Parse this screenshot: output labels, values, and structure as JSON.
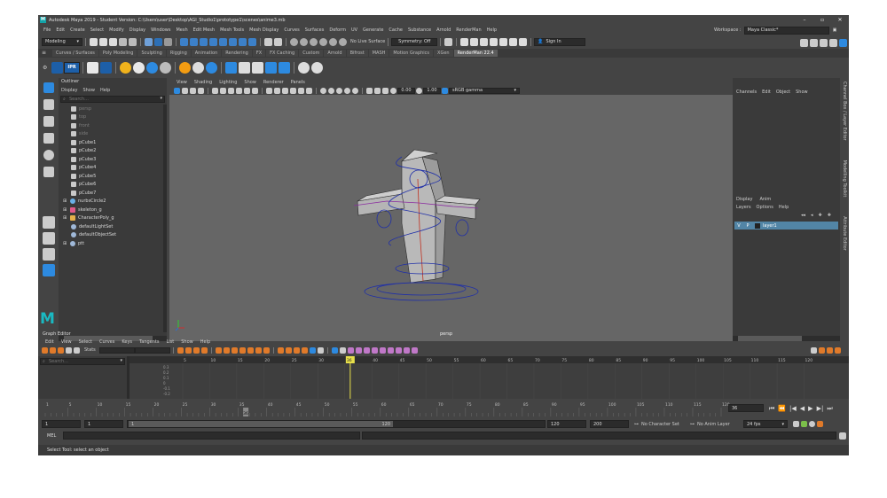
{
  "window": {
    "title": "Autodesk Maya 2019 - Student Version: C:\\Users\\user\\Desktop\\AGI_Studio1\\prototype1\\scenes\\anime3.mb"
  },
  "menubar": [
    "File",
    "Edit",
    "Create",
    "Select",
    "Modify",
    "Display",
    "Windows",
    "Mesh",
    "Edit Mesh",
    "Mesh Tools",
    "Mesh Display",
    "Curves",
    "Surfaces",
    "Deform",
    "UV",
    "Generate",
    "Cache",
    "Substance",
    "Arnold",
    "RenderMan",
    "Help"
  ],
  "workspace": {
    "label": "Workspace :",
    "value": "Maya Classic*"
  },
  "statusline": {
    "menuset": "Modeling",
    "live_surface": "No Live Surface",
    "symmetry": "Symmetry: Off",
    "sign_in": "Sign In"
  },
  "shelf_tabs": [
    "Curves / Surfaces",
    "Poly Modeling",
    "Sculpting",
    "Rigging",
    "Animation",
    "Rendering",
    "FX",
    "FX Caching",
    "Custom",
    "Arnold",
    "Bifrost",
    "MASH",
    "Motion Graphics",
    "XGen",
    "RenderMan 22.4"
  ],
  "shelf_active_tab": "RenderMan 22.4",
  "shelf_icons": [
    "IPR",
    "RfM"
  ],
  "outliner": {
    "title": "Outliner",
    "menu": [
      "Display",
      "Show",
      "Help"
    ],
    "search_placeholder": "Search...",
    "items": [
      {
        "label": "persp",
        "kind": "camera",
        "dim": true
      },
      {
        "label": "top",
        "kind": "camera",
        "dim": true
      },
      {
        "label": "front",
        "kind": "camera",
        "dim": true
      },
      {
        "label": "side",
        "kind": "camera",
        "dim": true
      },
      {
        "label": "pCube1",
        "kind": "mesh"
      },
      {
        "label": "pCube2",
        "kind": "mesh"
      },
      {
        "label": "pCube3",
        "kind": "mesh"
      },
      {
        "label": "pCube4",
        "kind": "mesh"
      },
      {
        "label": "pCube5",
        "kind": "mesh"
      },
      {
        "label": "pCube6",
        "kind": "mesh"
      },
      {
        "label": "pCube7",
        "kind": "mesh"
      },
      {
        "label": "nurbsCircle2",
        "kind": "curve",
        "expand": true
      },
      {
        "label": "skeleton_g",
        "kind": "joint",
        "expand": true
      },
      {
        "label": "CharacterPoly_g",
        "kind": "group",
        "expand": true
      },
      {
        "label": "defaultLightSet",
        "kind": "set"
      },
      {
        "label": "defaultObjectSet",
        "kind": "set"
      },
      {
        "label": "ptt",
        "kind": "set",
        "expand": true
      }
    ]
  },
  "viewport": {
    "menu": [
      "View",
      "Shading",
      "Lighting",
      "Show",
      "Renderer",
      "Panels"
    ],
    "camera_label": "persp",
    "field1": "0.00",
    "field2": "1.00",
    "color_space": "sRGB gamma",
    "accent": "#2d8ae0"
  },
  "channelbox": {
    "menu": [
      "Channels",
      "Edit",
      "Object",
      "Show"
    ],
    "tabs": [
      "Display",
      "Anim"
    ],
    "layer_menu": [
      "Layers",
      "Options",
      "Help"
    ],
    "layer": {
      "flag_v": "V",
      "flag_p": "P",
      "name": "layer1"
    },
    "side_tabs": [
      "Channel Box / Layer Editor",
      "Modelling Toolkit",
      "Attribute Editor"
    ]
  },
  "graph_editor": {
    "title": "Graph Editor",
    "menu": [
      "Edit",
      "View",
      "Select",
      "Curves",
      "Keys",
      "Tangents",
      "List",
      "Show",
      "Help"
    ],
    "stats_label": "Stats",
    "search_placeholder": "Search...",
    "ruler": [
      "5",
      "10",
      "15",
      "20",
      "25",
      "30",
      "35",
      "40",
      "45",
      "50",
      "55",
      "60",
      "65",
      "70",
      "75",
      "80",
      "85",
      "90",
      "95",
      "100",
      "105",
      "110",
      "115",
      "120"
    ],
    "v_ticks": [
      "0.3",
      "0.2",
      "0.1",
      "0",
      "-0.1",
      "-0.2"
    ],
    "current_frame": "36"
  },
  "timeslider": {
    "ticks": [
      "1",
      "5",
      "10",
      "15",
      "20",
      "25",
      "30",
      "35",
      "40",
      "45",
      "50",
      "55",
      "60",
      "65",
      "70",
      "75",
      "80",
      "85",
      "90",
      "95",
      "100",
      "105",
      "110",
      "115",
      "120"
    ],
    "current": "36",
    "frame_field": "36"
  },
  "range": {
    "start": "1",
    "inner_start": "1",
    "slider_start": "1",
    "slider_end": "120",
    "end": "120",
    "max": "200",
    "character": "No Character Set",
    "anim_layer": "No Anim Layer",
    "fps": "24 fps"
  },
  "cmdline": {
    "label": "MEL"
  },
  "help_line": "Select Tool: select an object"
}
